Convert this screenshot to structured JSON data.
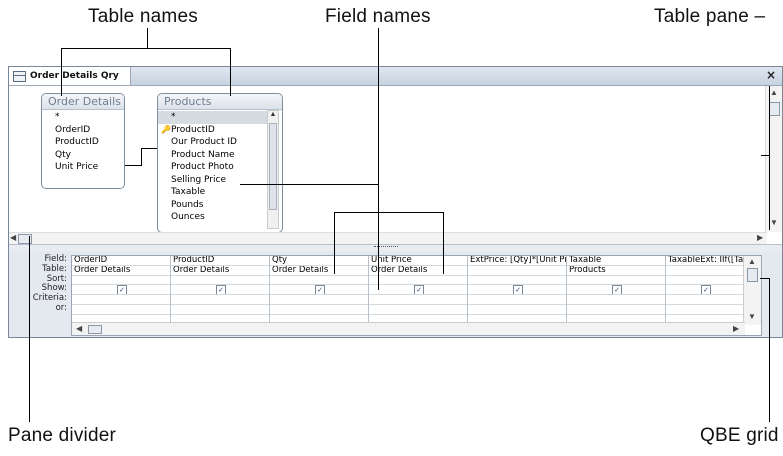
{
  "callouts": {
    "table_names": "Table names",
    "field_names": "Field names",
    "table_pane": "Table pane –",
    "pane_divider": "Pane divider",
    "qbe_grid": "QBE grid"
  },
  "window": {
    "tab_label": "Order Details Qry",
    "close_glyph": "×"
  },
  "tables": [
    {
      "name": "Order Details",
      "fields": [
        "*",
        "OrderID",
        "ProductID",
        "Qty",
        "Unit Price"
      ]
    },
    {
      "name": "Products",
      "fields": [
        "*",
        "ProductID",
        "Our Product ID",
        "Product Name",
        "Product Photo",
        "Selling Price",
        "Taxable",
        "Pounds",
        "Ounces"
      ]
    }
  ],
  "grid": {
    "row_labels": [
      "Field:",
      "Table:",
      "Sort:",
      "Show:",
      "Criteria:",
      "or:"
    ],
    "columns": [
      {
        "field": "OrderID",
        "table": "Order Details",
        "show": true
      },
      {
        "field": "ProductID",
        "table": "Order Details",
        "show": true
      },
      {
        "field": "Qty",
        "table": "Order Details",
        "show": true
      },
      {
        "field": "Unit Price",
        "table": "Order Details",
        "show": true
      },
      {
        "field": "ExtPrice: [Qty]*[Unit Pr",
        "table": "",
        "show": true
      },
      {
        "field": "Taxable",
        "table": "Products",
        "show": true
      },
      {
        "field": "TaxableExt: IIf([Taxabl",
        "table": "",
        "show": true
      }
    ]
  },
  "icons": {
    "key": "key-icon",
    "check": "✓"
  }
}
